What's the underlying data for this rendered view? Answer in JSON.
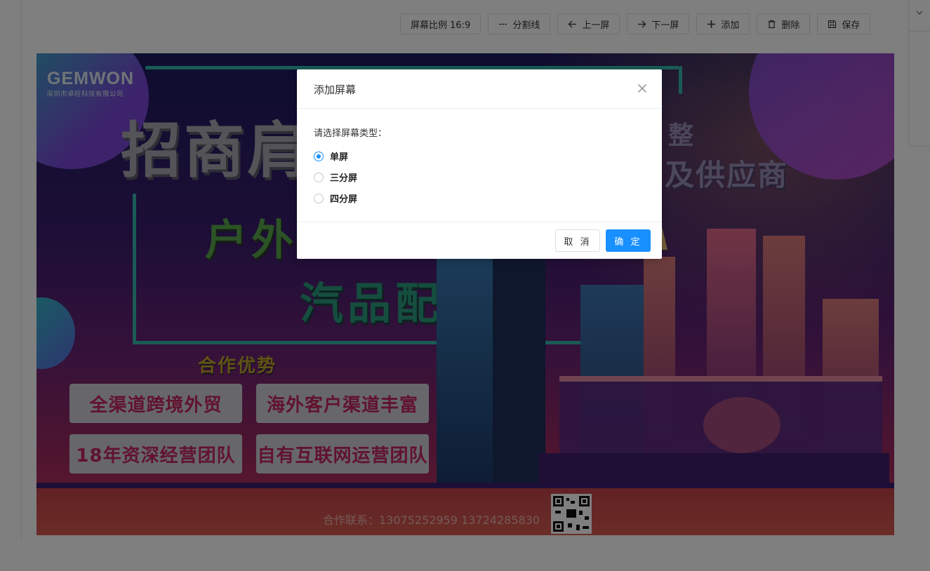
{
  "toolbar": {
    "ratio_label": "屏幕比例 16:9",
    "divider_label": "分割线",
    "prev_label": "上一屏",
    "next_label": "下一屏",
    "add_label": "添加",
    "delete_label": "删除",
    "save_label": "保存"
  },
  "poster": {
    "logo": "GEMWON",
    "logo_sub": "深圳市卓旺科技有限公司",
    "title_main": "招商肩",
    "title_right_top": "整",
    "title_right": "及供应商",
    "subtitle_1": "户外",
    "subtitle_2": "汽品配件",
    "advantage_title": "合作优势",
    "features": [
      "全渠道跨境外贸",
      "海外客户渠道丰富",
      "18年资深经营团队",
      "自有互联网运营团队"
    ],
    "contact": "合作联系：13075252959   13724285830"
  },
  "modal": {
    "title": "添加屏幕",
    "prompt": "请选择屏幕类型：",
    "options": [
      "单屏",
      "三分屏",
      "四分屏"
    ],
    "selected": "单屏",
    "cancel_label": "取 消",
    "confirm_label": "确 定"
  },
  "colors": {
    "accent": "#1890ff",
    "overlay": "rgba(0,0,0,0.5)"
  }
}
